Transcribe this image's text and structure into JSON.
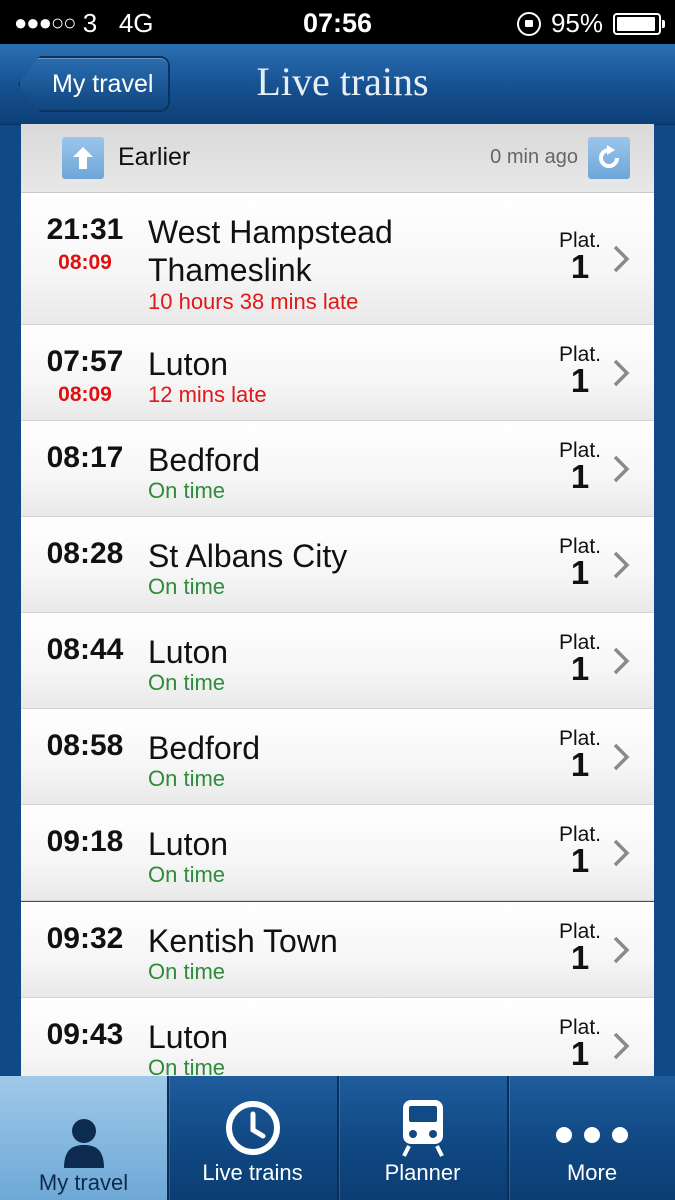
{
  "status_bar": {
    "signal": "●●●○○",
    "carrier": "3",
    "network": "4G",
    "time": "07:56",
    "battery": "95%"
  },
  "nav": {
    "back_label": "My travel",
    "title": "Live trains"
  },
  "earlier": {
    "label": "Earlier",
    "updated": "0 min ago"
  },
  "trains": [
    {
      "time": "21:31",
      "expected": "08:09",
      "destination": "West Hampstead Thameslink",
      "status": "10 hours 38 mins late",
      "status_type": "late",
      "platform_label": "Plat.",
      "platform": "1"
    },
    {
      "time": "07:57",
      "expected": "08:09",
      "destination": "Luton",
      "status": "12 mins late",
      "status_type": "late",
      "platform_label": "Plat.",
      "platform": "1"
    },
    {
      "time": "08:17",
      "expected": "",
      "destination": "Bedford",
      "status": "On time",
      "status_type": "ok",
      "platform_label": "Plat.",
      "platform": "1"
    },
    {
      "time": "08:28",
      "expected": "",
      "destination": "St Albans City",
      "status": "On time",
      "status_type": "ok",
      "platform_label": "Plat.",
      "platform": "1"
    },
    {
      "time": "08:44",
      "expected": "",
      "destination": "Luton",
      "status": "On time",
      "status_type": "ok",
      "platform_label": "Plat.",
      "platform": "1"
    },
    {
      "time": "08:58",
      "expected": "",
      "destination": "Bedford",
      "status": "On time",
      "status_type": "ok",
      "platform_label": "Plat.",
      "platform": "1"
    },
    {
      "time": "09:18",
      "expected": "",
      "destination": "Luton",
      "status": "On time",
      "status_type": "ok",
      "platform_label": "Plat.",
      "platform": "1"
    },
    {
      "time": "09:32",
      "expected": "",
      "destination": "Kentish Town",
      "status": "On time",
      "status_type": "ok",
      "platform_label": "Plat.",
      "platform": "1"
    },
    {
      "time": "09:43",
      "expected": "",
      "destination": "Luton",
      "status": "On time",
      "status_type": "ok",
      "platform_label": "Plat.",
      "platform": "1"
    }
  ],
  "tabs": [
    {
      "label": "My travel",
      "icon": "person-icon",
      "active": true
    },
    {
      "label": "Live trains",
      "icon": "clock-icon",
      "active": false
    },
    {
      "label": "Planner",
      "icon": "train-icon",
      "active": false
    },
    {
      "label": "More",
      "icon": "more-dots-icon",
      "active": false
    }
  ],
  "colors": {
    "late": "#e01818",
    "on_time": "#2e8b3a",
    "nav_blue": "#15508f",
    "active_tab": "#8dbde4"
  }
}
